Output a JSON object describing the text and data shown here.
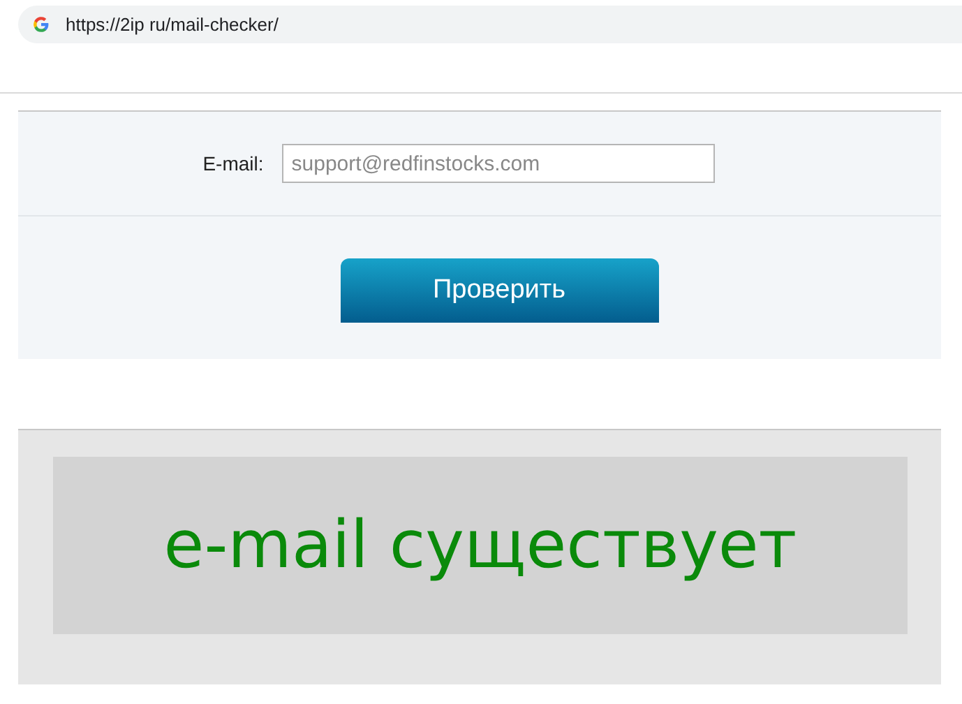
{
  "address_bar": {
    "url": "https://2ip ru/mail-checker/"
  },
  "form": {
    "email_label": "E-mail:",
    "email_value": "support@redfinstocks.com",
    "submit_button": "Проверить"
  },
  "result": {
    "message": "e-mail существует"
  }
}
